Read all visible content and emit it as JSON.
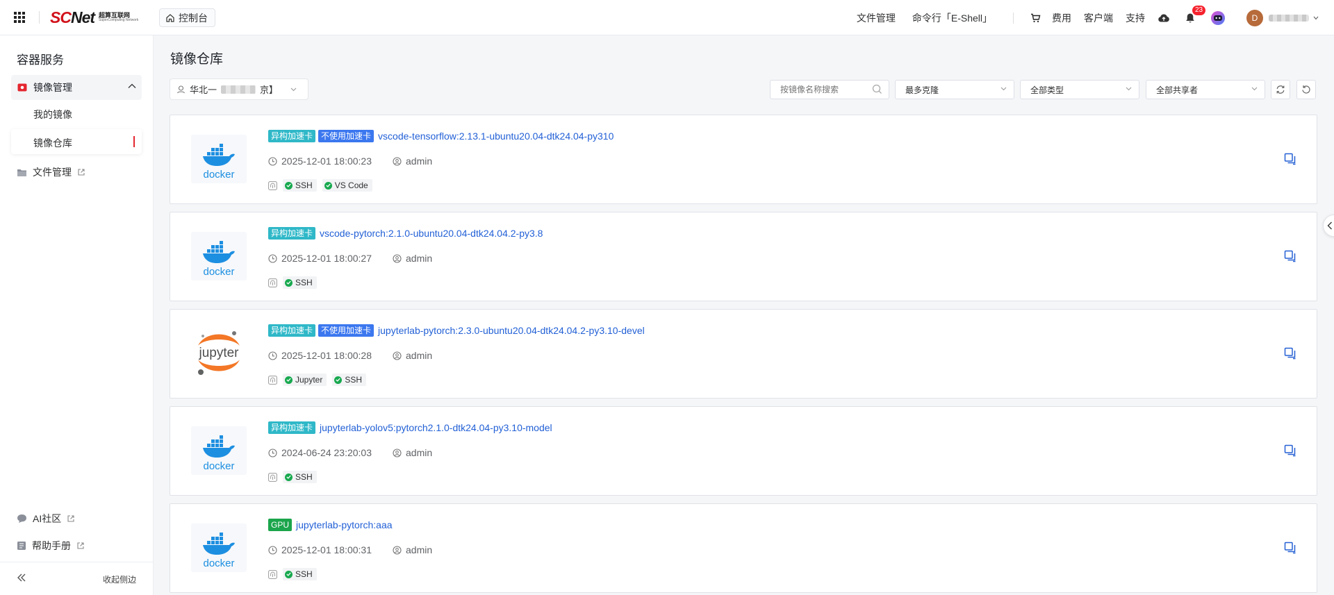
{
  "header": {
    "logo_sc": "SC",
    "logo_net": "Net",
    "logo_sub_cn": "超算互联网",
    "logo_sub_en": "SuperComputing Network",
    "console_label": "控制台",
    "nav": {
      "file_manage": "文件管理",
      "eshell": "命令行「E-Shell」",
      "fees": "费用",
      "client": "客户端",
      "support": "支持"
    },
    "notification_count": "23",
    "avatar_letter": "D"
  },
  "sidebar": {
    "title": "容器服务",
    "group_label": "镜像管理",
    "sub_items": [
      "我的镜像",
      "镜像仓库"
    ],
    "file_manage": "文件管理",
    "ai_community": "AI社区",
    "help_manual": "帮助手册",
    "collapse_label": "收起侧边"
  },
  "main": {
    "title": "镜像仓库",
    "region_prefix": "华北一",
    "region_suffix": "京】",
    "search_placeholder": "按镜像名称搜索",
    "sort_value": "最多克隆",
    "type_value": "全部类型",
    "sharer_value": "全部共享者"
  },
  "images": [
    {
      "tags": [
        {
          "label": "异构加速卡",
          "kind": "cyan"
        },
        {
          "label": "不使用加速卡",
          "kind": "blue"
        }
      ],
      "name": "vscode-tensorflow:2.13.1-ubuntu20.04-dtk24.04-py310",
      "time": "2025-12-01 18:00:23",
      "owner": "admin",
      "logo": "docker",
      "features": [
        "SSH",
        "VS Code"
      ]
    },
    {
      "tags": [
        {
          "label": "异构加速卡",
          "kind": "cyan"
        }
      ],
      "name": "vscode-pytorch:2.1.0-ubuntu20.04-dtk24.04.2-py3.8",
      "time": "2025-12-01 18:00:27",
      "owner": "admin",
      "logo": "docker",
      "features": [
        "SSH"
      ]
    },
    {
      "tags": [
        {
          "label": "异构加速卡",
          "kind": "cyan"
        },
        {
          "label": "不使用加速卡",
          "kind": "blue"
        }
      ],
      "name": "jupyterlab-pytorch:2.3.0-ubuntu20.04-dtk24.04.2-py3.10-devel",
      "time": "2025-12-01 18:00:28",
      "owner": "admin",
      "logo": "jupyter",
      "features": [
        "Jupyter",
        "SSH"
      ]
    },
    {
      "tags": [
        {
          "label": "异构加速卡",
          "kind": "cyan"
        }
      ],
      "name": "jupyterlab-yolov5:pytorch2.1.0-dtk24.04-py3.10-model",
      "time": "2024-06-24 23:20:03",
      "owner": "admin",
      "logo": "docker",
      "features": [
        "SSH"
      ]
    },
    {
      "tags": [
        {
          "label": "GPU",
          "kind": "green"
        }
      ],
      "name": "jupyterlab-pytorch:aaa",
      "time": "2025-12-01 18:00:31",
      "owner": "admin",
      "logo": "docker",
      "features": [
        "SSH"
      ]
    }
  ],
  "logo_texts": {
    "docker": "docker",
    "jupyter": "jupyter"
  },
  "colors": {
    "accent": "#2260d6",
    "brand_red": "#d1121b",
    "tag_cyan": "#2fb8c8",
    "tag_blue": "#3b77ef",
    "tag_green": "#1ba54c",
    "ok_green": "#18a94f"
  }
}
